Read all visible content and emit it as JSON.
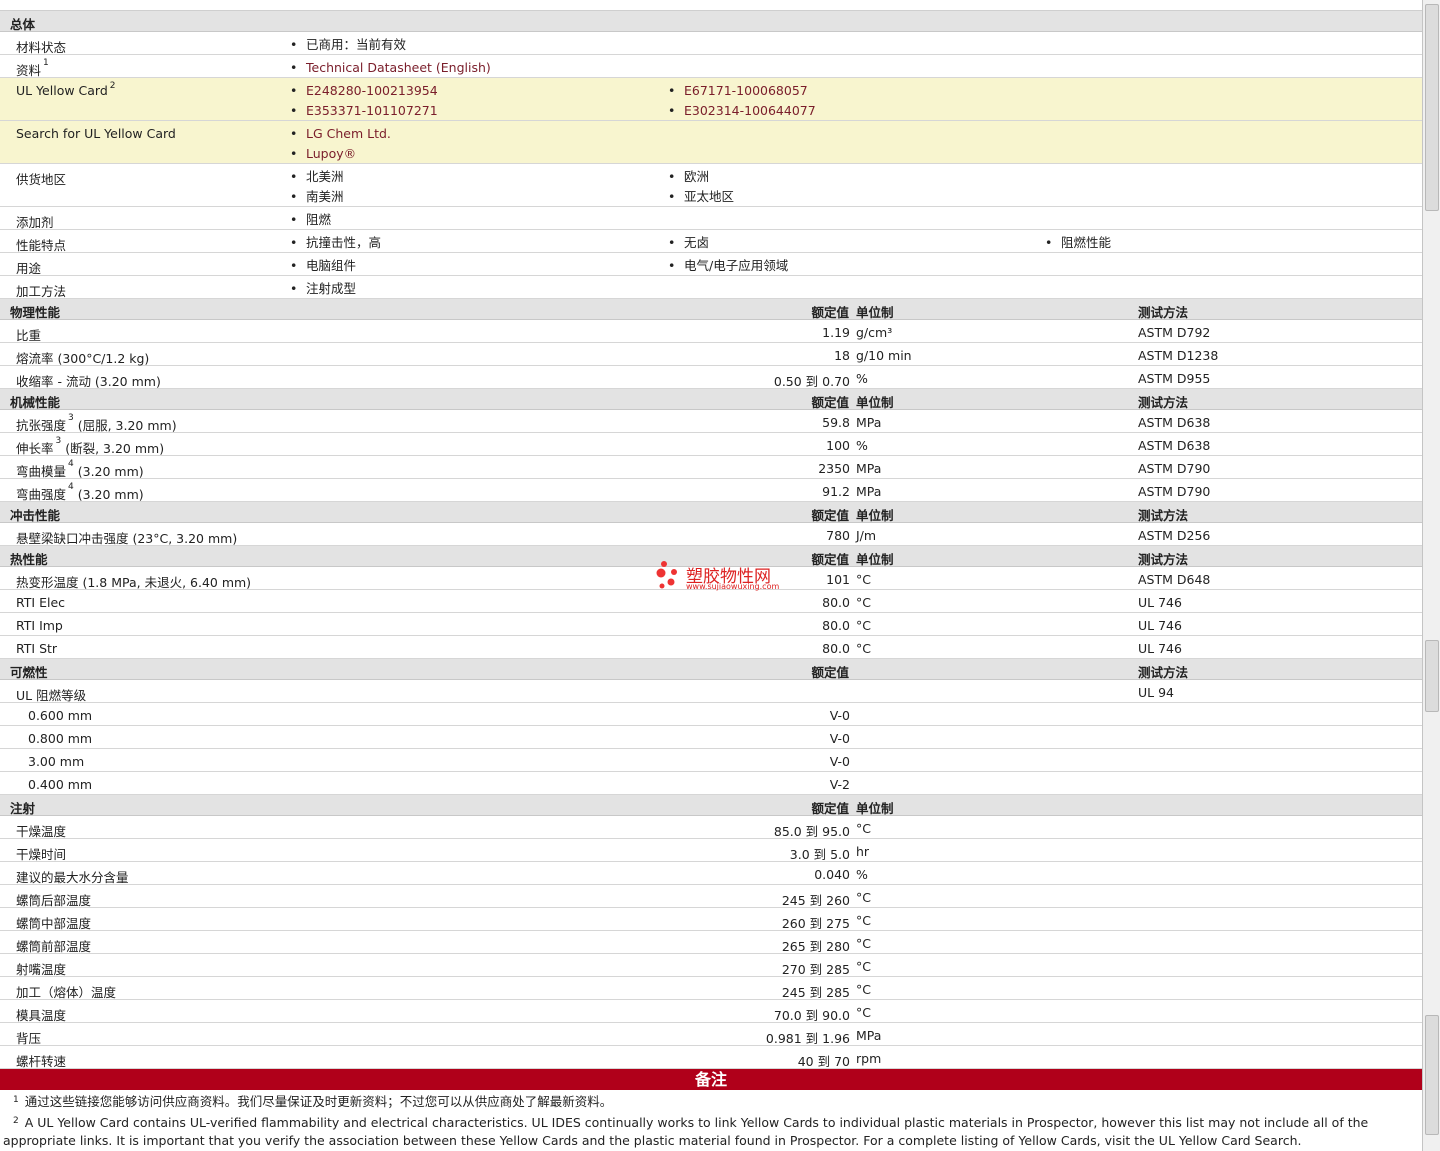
{
  "general": {
    "title": "总体",
    "material_status": {
      "label": "材料状态",
      "items": [
        "已商用：当前有效"
      ]
    },
    "sources": {
      "label": "资料",
      "sup": "1",
      "items": [
        "Technical Datasheet (English)"
      ]
    },
    "yellow_card": {
      "label": "UL Yellow Card",
      "sup": "2",
      "items": [
        "E248280-100213954",
        "E67171-100068057",
        "E353371-101107271",
        "E302314-100644077"
      ]
    },
    "search_yellow": {
      "label": "Search for UL Yellow Card",
      "items": [
        "LG Chem Ltd.",
        "Lupoy®"
      ]
    },
    "regions": {
      "label": "供货地区",
      "items": [
        "北美洲",
        "欧洲",
        "南美洲",
        "亚太地区"
      ]
    },
    "additive": {
      "label": "添加剂",
      "items": [
        "阻燃"
      ]
    },
    "features": {
      "label": "性能特点",
      "items": [
        "抗撞击性，高",
        "无卤",
        "阻燃性能"
      ]
    },
    "uses": {
      "label": "用途",
      "items": [
        "电脑组件",
        "电气/电子应用领域"
      ]
    },
    "processing": {
      "label": "加工方法",
      "items": [
        "注射成型"
      ]
    }
  },
  "headers": {
    "value": "额定值",
    "unit": "单位制",
    "method": "测试方法"
  },
  "physical": {
    "title": "物理性能",
    "rows": [
      {
        "label": "比重",
        "value": "1.19",
        "unit": "g/cm³",
        "method": "ASTM D792"
      },
      {
        "label": "熔流率  (300°C/1.2 kg)",
        "value": "18",
        "unit": "g/10 min",
        "method": "ASTM D1238"
      },
      {
        "label": "收缩率  - 流动  (3.20 mm)",
        "value": "0.50 到  0.70",
        "unit": "%",
        "method": "ASTM D955"
      }
    ]
  },
  "mechanical": {
    "title": "机械性能",
    "rows": [
      {
        "label": "抗张强度",
        "sup": "3",
        "extra": "(屈服, 3.20 mm)",
        "value": "59.8",
        "unit": "MPa",
        "method": "ASTM D638"
      },
      {
        "label": "伸长率",
        "sup": "3",
        "extra": "(断裂, 3.20 mm)",
        "value": "100",
        "unit": "%",
        "method": "ASTM D638"
      },
      {
        "label": "弯曲模量",
        "sup": "4",
        "extra": "(3.20 mm)",
        "value": "2350",
        "unit": "MPa",
        "method": "ASTM D790"
      },
      {
        "label": "弯曲强度",
        "sup": "4",
        "extra": "(3.20 mm)",
        "value": "91.2",
        "unit": "MPa",
        "method": "ASTM D790"
      }
    ]
  },
  "impact": {
    "title": "冲击性能",
    "rows": [
      {
        "label": "悬壁梁缺口冲击强度  (23°C, 3.20 mm)",
        "value": "780",
        "unit": "J/m",
        "method": "ASTM D256"
      }
    ]
  },
  "thermal": {
    "title": "热性能",
    "rows": [
      {
        "label": "热变形温度  (1.8 MPa, 未退火, 6.40 mm)",
        "value": "101",
        "unit": "°C",
        "method": "ASTM D648"
      },
      {
        "label": "RTI Elec",
        "value": "80.0",
        "unit": "°C",
        "method": "UL 746"
      },
      {
        "label": "RTI Imp",
        "value": "80.0",
        "unit": "°C",
        "method": "UL 746"
      },
      {
        "label": "RTI Str",
        "value": "80.0",
        "unit": "°C",
        "method": "UL 746"
      }
    ]
  },
  "flammability": {
    "title": "可燃性",
    "rows": [
      {
        "label": "UL 阻燃等级",
        "value": "",
        "unit": "",
        "method": "UL 94"
      },
      {
        "label": "0.600 mm",
        "value": "V-0",
        "sub": true
      },
      {
        "label": "0.800 mm",
        "value": "V-0",
        "sub": true
      },
      {
        "label": "3.00 mm",
        "value": "V-0",
        "sub": true
      },
      {
        "label": "0.400 mm",
        "value": "V-2",
        "sub": true
      }
    ]
  },
  "injection": {
    "title": "注射",
    "rows": [
      {
        "label": "干燥温度",
        "value": "85.0 到  95.0",
        "unit": "°C"
      },
      {
        "label": "干燥时间",
        "value": "3.0 到  5.0",
        "unit": "hr"
      },
      {
        "label": "建议的最大水分含量",
        "value": "0.040",
        "unit": "%"
      },
      {
        "label": "螺筒后部温度",
        "value": "245 到  260",
        "unit": "°C"
      },
      {
        "label": "螺筒中部温度",
        "value": "260 到  275",
        "unit": "°C"
      },
      {
        "label": "螺筒前部温度",
        "value": "265 到  280",
        "unit": "°C"
      },
      {
        "label": "射嘴温度",
        "value": "270 到  285",
        "unit": "°C"
      },
      {
        "label": "加工（熔体）温度",
        "value": "245 到  285",
        "unit": "°C"
      },
      {
        "label": "模具温度",
        "value": "70.0 到  90.0",
        "unit": "°C"
      },
      {
        "label": "背压",
        "value": "0.981 到  1.96",
        "unit": "MPa"
      },
      {
        "label": "螺杆转速",
        "value": "40 到  70",
        "unit": "rpm"
      }
    ]
  },
  "notes": {
    "title": "备注",
    "items": [
      {
        "num": "1",
        "text": "通过这些链接您能够访问供应商资料。我们尽量保证及时更新资料；不过您可以从供应商处了解最新资料。"
      },
      {
        "num": "2",
        "text": "A UL Yellow Card contains UL-verified flammability and electrical characteristics. UL IDES continually works to link Yellow Cards to individual plastic materials in Prospector, however this list may not include all of the appropriate links. It is important that you verify the association between these Yellow Cards and the plastic material found in Prospector. For a complete listing of Yellow Cards, visit the UL Yellow Card Search."
      }
    ]
  },
  "watermark": {
    "title": "塑胶物性网",
    "url": "www.sujiaowuxing.com",
    "color": "#dd2222"
  },
  "colors": {
    "section_bg": "#e3e3e3",
    "highlight_bg": "#f8f5cf",
    "notes_bar": "#b0001a",
    "link": "#7a1d2a"
  }
}
